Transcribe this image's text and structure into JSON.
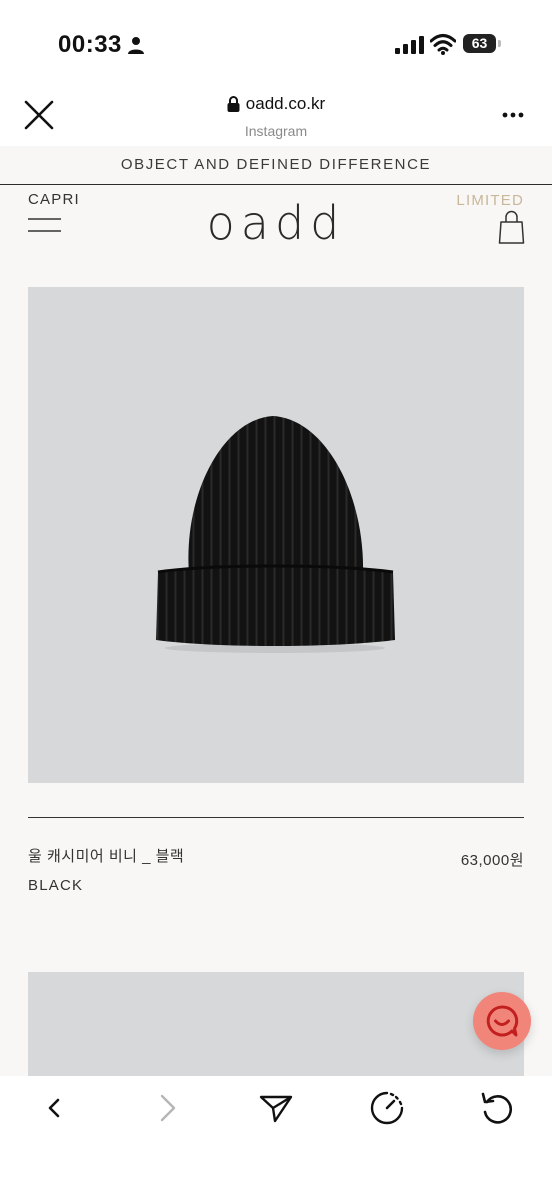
{
  "status_bar": {
    "time": "00:33",
    "battery": "63"
  },
  "browser": {
    "url": "oadd.co.kr",
    "source": "Instagram"
  },
  "site": {
    "banner": "OBJECT AND DEFINED DIFFERENCE",
    "location": "CAPRI",
    "logo": "oadd",
    "limited": "LIMITED"
  },
  "product": {
    "name": "울 캐시미어 비니 _ 블랙",
    "price": "63,000원",
    "color": "BLACK"
  },
  "icons": {
    "close": "close-icon",
    "lock": "lock-icon",
    "more": "more-icon",
    "menu": "menu-icon",
    "bag": "shopping-bag-icon",
    "chat": "chat-icon",
    "back": "chevron-left-icon",
    "forward": "chevron-right-icon",
    "share": "send-icon",
    "speed": "speedometer-icon",
    "reload": "reload-icon"
  },
  "colors": {
    "chat_button": "#f1857a",
    "limited": "#c9b79a",
    "image_bg": "#d6d8da"
  }
}
